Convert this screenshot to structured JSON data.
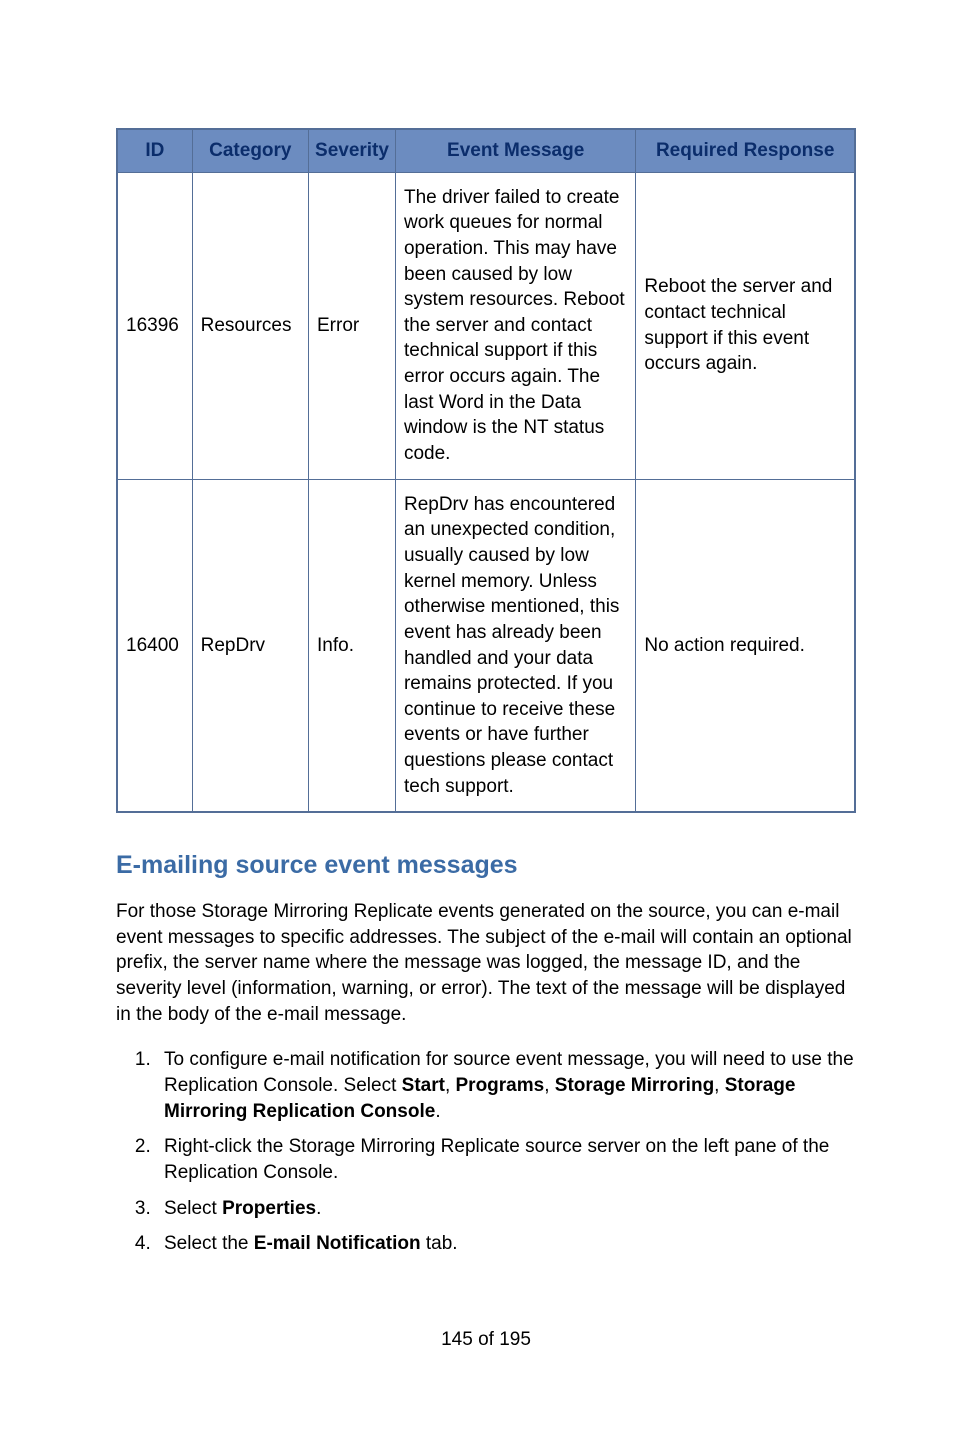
{
  "table": {
    "headers": [
      "ID",
      "Category",
      "Severity",
      "Event Message",
      "Required Response"
    ],
    "rows": [
      {
        "id": "16396",
        "category": "Resources",
        "severity": "Error",
        "message": "The driver failed to create work queues for normal operation. This may have been caused by low system resources. Reboot the server and contact technical support if this error occurs again. The last Word in the Data window is the NT status code.",
        "response": "Reboot the server and contact technical support if this event occurs again."
      },
      {
        "id": "16400",
        "category": "RepDrv",
        "severity": "Info.",
        "message": "RepDrv has encountered an unexpected condition, usually caused by low kernel memory. Unless otherwise mentioned, this event has already been handled and your data remains protected. If you continue to receive these events or have further questions please contact tech support.",
        "response": "No action required."
      }
    ]
  },
  "section_heading": "E-mailing source event messages",
  "intro_paragraph": "For those Storage Mirroring Replicate events generated on the source, you can e-mail event messages to specific addresses. The subject of the e-mail will contain an optional prefix, the server name where the message was logged, the message ID, and the severity level (information, warning, or error). The text of the message will be displayed in the body of the e-mail message.",
  "steps": {
    "s1": {
      "pre": "To configure e-mail notification for source event message, you will need to use the Replication Console. Select ",
      "b1": "Start",
      "sep1": ", ",
      "b2": "Programs",
      "sep2": ", ",
      "b3": "Storage Mirroring",
      "sep3": ", ",
      "b4": "Storage Mirroring Replication Console",
      "post": "."
    },
    "s2": "Right-click the Storage Mirroring Replicate source server on the left pane of the Replication Console.",
    "s3": {
      "pre": "Select ",
      "b": "Properties",
      "post": "."
    },
    "s4": {
      "pre": "Select the ",
      "b": "E-mail Notification",
      "post": " tab."
    }
  },
  "page_number": "145 of 195"
}
